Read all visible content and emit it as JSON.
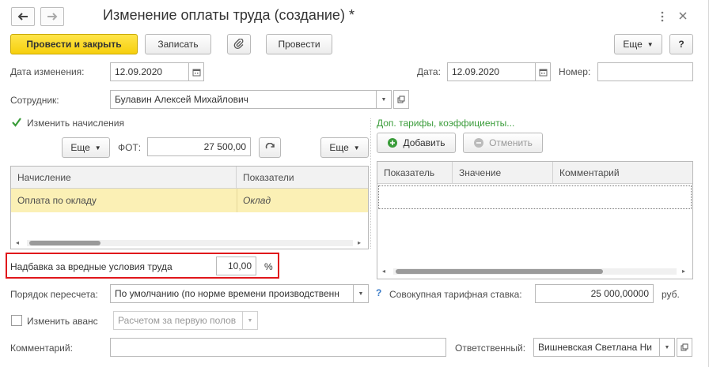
{
  "window": {
    "title": "Изменение оплаты труда (создание) *"
  },
  "toolbar": {
    "post_close": "Провести и закрыть",
    "save": "Записать",
    "post": "Провести",
    "more": "Еще",
    "help": "?"
  },
  "form": {
    "change_date_label": "Дата изменения:",
    "change_date_value": "12.09.2020",
    "date_label": "Дата:",
    "date_value": "12.09.2020",
    "number_label": "Номер:",
    "number_value": "",
    "employee_label": "Сотрудник:",
    "employee_value": "Булавин Алексей Михайлович",
    "change_accruals_label": "Изменить начисления",
    "change_accruals_checked": true,
    "more_left": "Еще",
    "fot_label": "ФОТ:",
    "fot_value": "27 500,00",
    "more_mid": "Еще",
    "extra_tariffs_link": "Доп. тарифы, коэффициенты...",
    "add_button": "Добавить",
    "cancel_button": "Отменить",
    "hazard_label": "Надбавка за вредные условия труда",
    "hazard_value": "10,00",
    "hazard_unit": "%",
    "recalc_label": "Порядок пересчета:",
    "recalc_value": "По умолчанию (по норме времени производственн",
    "help_q": "?",
    "total_rate_label": "Совокупная тарифная ставка:",
    "total_rate_value": "25 000,00000",
    "total_rate_unit": "руб.",
    "change_advance_label": "Изменить аванс",
    "change_advance_checked": false,
    "advance_value": "Расчетом за первую полов",
    "comment_label": "Комментарий:",
    "comment_value": "",
    "responsible_label": "Ответственный:",
    "responsible_value": "Вишневская Светлана Ни"
  },
  "accruals_table": {
    "columns": [
      "Начисление",
      "Показатели"
    ],
    "rows": [
      {
        "accrual": "Оплата по окладу",
        "indicator": "Оклад"
      }
    ]
  },
  "indicators_table": {
    "columns": [
      "Показатель",
      "Значение",
      "Комментарий"
    ]
  },
  "colors": {
    "primary_button": "#f6cf0d",
    "selected_row": "#fbf0b5",
    "highlight_frame": "#e0171b",
    "link_green": "#3a9c3a"
  }
}
